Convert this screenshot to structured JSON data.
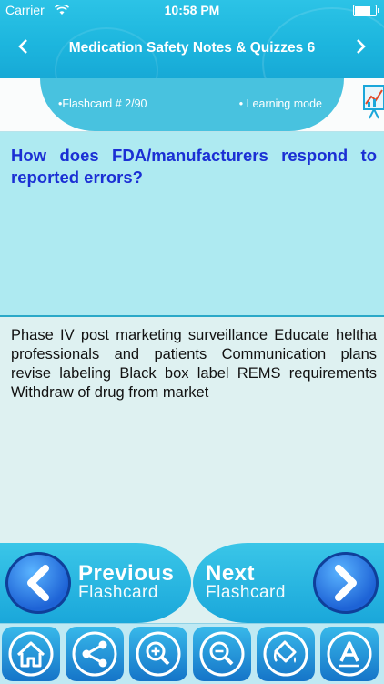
{
  "status": {
    "carrier": "Carrier",
    "time": "10:58 PM",
    "battery_level": 0.85
  },
  "header": {
    "title": "Medication Safety Notes & Quizzes 6",
    "back_icon": "chevron-left-icon",
    "forward_icon": "chevron-right-icon"
  },
  "info": {
    "flashcard": "•Flashcard #  2/90",
    "mode": "• Learning mode"
  },
  "question": "How does FDA/manufacturers respond to reported errors?",
  "answer": "Phase IV post marketing surveillance Educate heltha professionals and patients Communication plans revise labeling Black box label REMS requirements Withdraw of drug from market",
  "navigation": {
    "previous": {
      "line1": "Previous",
      "line2": "Flashcard"
    },
    "next": {
      "line1": "Next",
      "line2": "Flashcard"
    }
  },
  "toolbar": [
    "home-icon",
    "share-icon",
    "zoom-in-icon",
    "zoom-out-icon",
    "paint-bucket-icon",
    "font-icon"
  ],
  "colors": {
    "header": "#1db6de",
    "question_text": "#1b2fd4",
    "question_bg": "#aeeaf1",
    "answer_bg": "#def1f1"
  }
}
